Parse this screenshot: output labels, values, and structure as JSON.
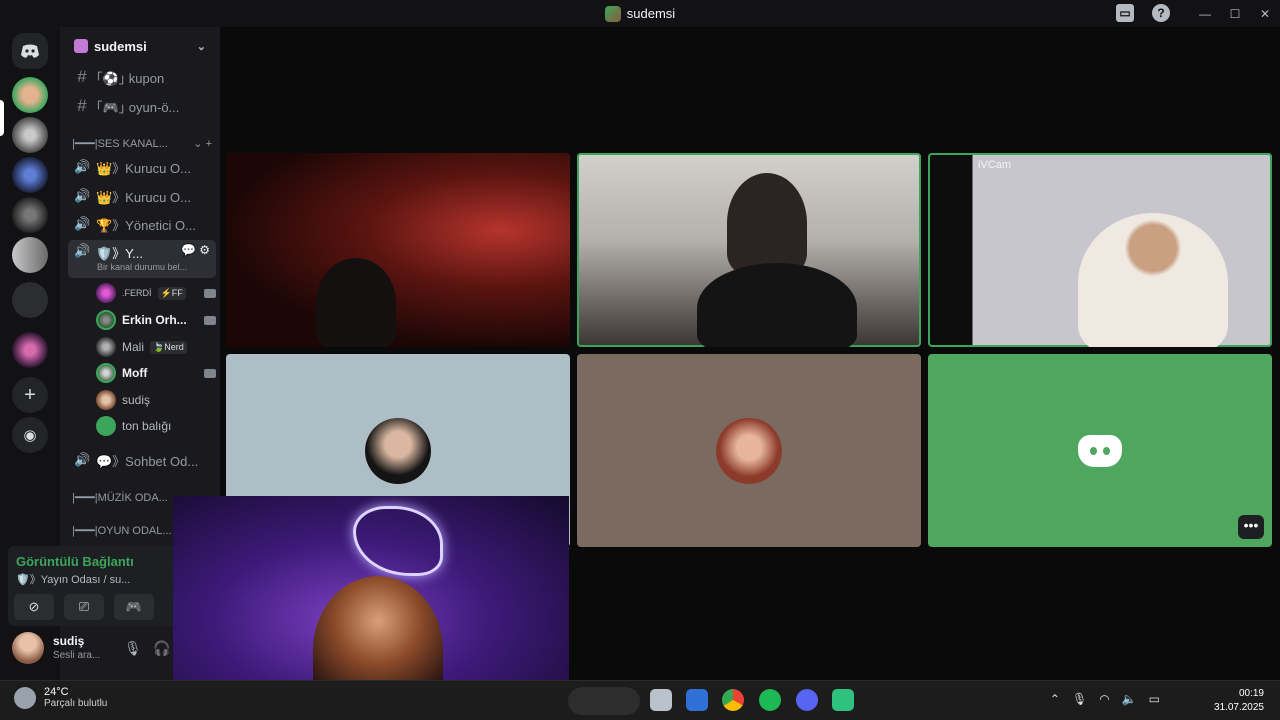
{
  "window": {
    "title": "sudemsi"
  },
  "server": {
    "name": "sudemsi"
  },
  "channels": {
    "text": [
      {
        "label": "｢⚽｣ kupon"
      },
      {
        "label": "｢🎮｣ oyun-ö..."
      }
    ],
    "cat_voice": "|━━━|SES KANAL...",
    "voice": [
      {
        "label": "👑》Kurucu O..."
      },
      {
        "label": "👑》Kurucu O..."
      },
      {
        "label": "🏆》Yönetici O..."
      }
    ],
    "active": {
      "label": "🛡️》Y...",
      "status": "Bir kanal durumu bel..."
    },
    "users": [
      {
        "name": ".FERDİ",
        "tag": "⚡FF",
        "cam": true
      },
      {
        "name": "Erkin Orh...",
        "bold": true,
        "cam": true
      },
      {
        "name": "Mali",
        "tag": "🍃Nerd"
      },
      {
        "name": "Moff",
        "bold": true,
        "cam": true
      },
      {
        "name": "sudiş"
      },
      {
        "name": "ton balığı"
      }
    ],
    "chat_room": "💬》Sohbet Od...",
    "cat_music": "|━━━|MÜZİK ODA...",
    "cat_game": "|━━━|OYUN ODAL..."
  },
  "voice_panel": {
    "title": "Görüntülü Bağlantı",
    "subtitle": "🛡️》Yayın Odası / su..."
  },
  "self": {
    "name": "sudiş",
    "status": "Sesli ara..."
  },
  "tiles": {
    "top_right_label": "iVCam"
  },
  "taskbar": {
    "temp": "24°C",
    "weather": "Parçalı bulutlu",
    "time": "00:19",
    "date": "31.07.2025"
  },
  "icons": [
    "discord-icon",
    "home-icon",
    "hash-icon",
    "speaker-icon",
    "camera-icon",
    "mic-icon",
    "headphones-icon",
    "settings-icon",
    "add-icon",
    "compass-icon",
    "more-icon",
    "wifi-icon",
    "volume-icon",
    "battery-icon"
  ]
}
